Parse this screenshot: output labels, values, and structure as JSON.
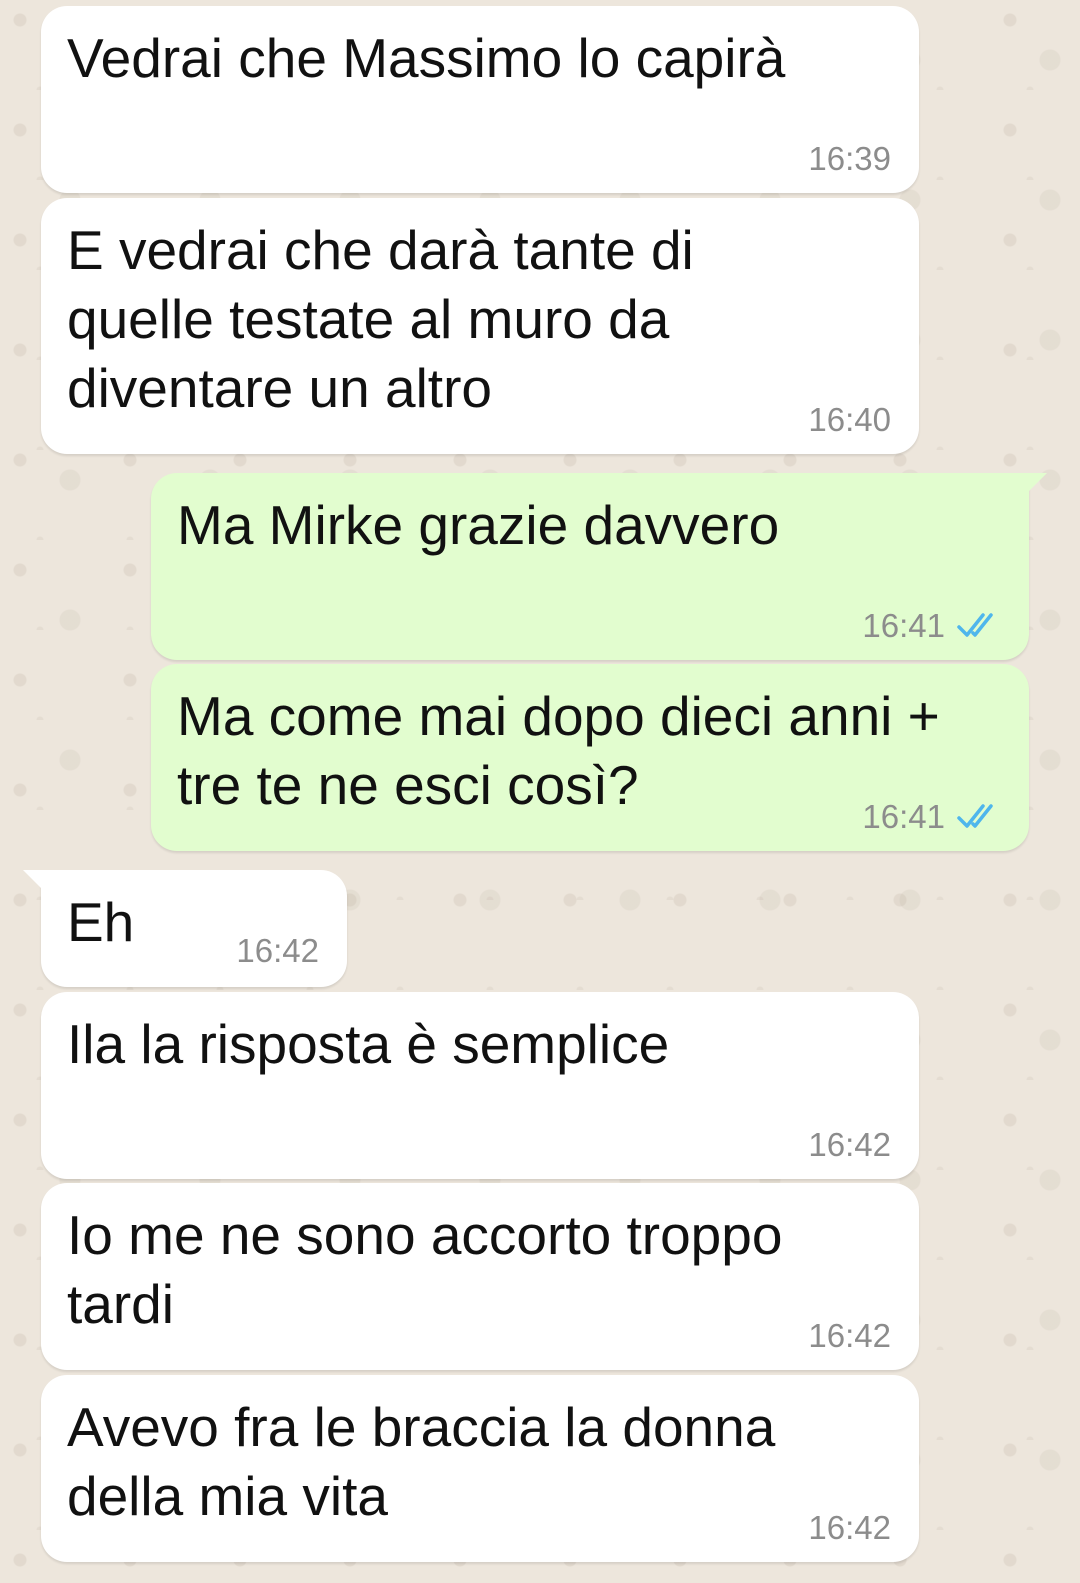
{
  "messages": [
    {
      "direction": "in",
      "text": "Vedrai che Massimo lo capirà",
      "time": "16:39"
    },
    {
      "direction": "in",
      "text": "E vedrai che darà tante di\nquelle testate al muro da\ndiventare un altro",
      "time": "16:40"
    },
    {
      "direction": "out",
      "text": "Ma Mirke grazie davvero",
      "time": "16:41",
      "status": "read"
    },
    {
      "direction": "out",
      "text": "Ma come mai dopo dieci anni +\ntre te ne esci così?",
      "time": "16:41",
      "status": "read"
    },
    {
      "direction": "in",
      "text": "Eh",
      "time": "16:42"
    },
    {
      "direction": "in",
      "text": "Ila la risposta è semplice",
      "time": "16:42"
    },
    {
      "direction": "in",
      "text": "Io me ne sono accorto troppo\ntardi",
      "time": "16:42"
    },
    {
      "direction": "in",
      "text": "Avevo fra le braccia la donna\ndella mia vita",
      "time": "16:42"
    }
  ],
  "colors": {
    "incoming_bubble": "#ffffff",
    "outgoing_bubble": "#e2fdcf",
    "read_ticks": "#4fb6ec",
    "timestamp": "#8c8c8c",
    "wallpaper": "#ede6dc"
  },
  "icons": {
    "read_status": "double-check-icon"
  }
}
